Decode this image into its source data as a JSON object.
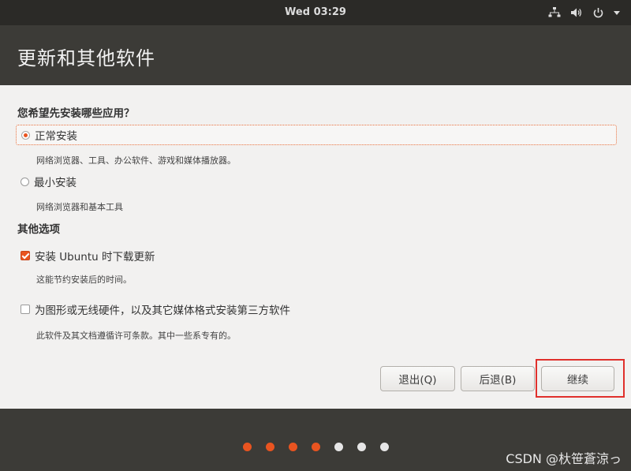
{
  "top_panel": {
    "clock": "Wed 03:29",
    "indicators": [
      "network-icon",
      "volume-icon",
      "power-icon"
    ]
  },
  "header": {
    "title": "更新和其他软件"
  },
  "content": {
    "question": "您希望先安装哪些应用？",
    "install_options": [
      {
        "label": "正常安装",
        "description": "网络浏览器、工具、办公软件、游戏和媒体播放器。",
        "selected": true
      },
      {
        "label": "最小安装",
        "description": "网络浏览器和基本工具",
        "selected": false
      }
    ],
    "other_section_title": "其他选项",
    "other_options": [
      {
        "label": "安装 Ubuntu 时下载更新",
        "description": "这能节约安装后的时间。",
        "checked": true
      },
      {
        "label": "为图形或无线硬件，以及其它媒体格式安装第三方软件",
        "description": "此软件及其文档遵循许可条款。其中一些系专有的。",
        "checked": false
      }
    ]
  },
  "buttons": {
    "quit": "退出(Q)",
    "back": "后退(B)",
    "continue": "继续"
  },
  "progress": {
    "total_steps": 7,
    "completed_steps": 4,
    "active_color": "#e95420",
    "inactive_color": "#e6e6e6"
  },
  "watermark": "CSDN @杕笹蒼涼っ",
  "colors": {
    "accent": "#e95420",
    "highlight_box": "#e0302c"
  }
}
